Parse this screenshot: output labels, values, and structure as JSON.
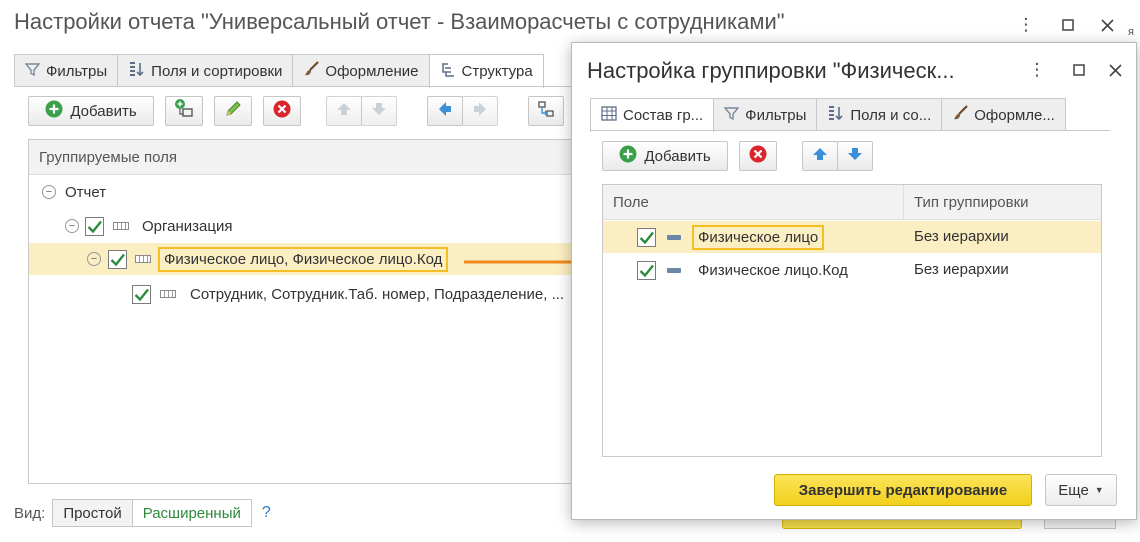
{
  "main": {
    "title": "Настройки отчета \"Универсальный отчет - Взаиморасчеты с сотрудниками\"",
    "clipped_text": "я",
    "tabs": [
      {
        "label": "Фильтры",
        "icon": "funnel-icon"
      },
      {
        "label": "Поля и сортировки",
        "icon": "fields-sort-icon"
      },
      {
        "label": "Оформление",
        "icon": "brush-icon"
      },
      {
        "label": "Структура",
        "icon": "structure-icon",
        "active": true
      }
    ],
    "toolbar": {
      "add_label": "Добавить",
      "icons": [
        "add-icon",
        "group-add-icon",
        "pencil-icon",
        "delete-icon",
        "move-up-icon",
        "move-down-icon",
        "move-left-icon",
        "move-right-icon",
        "swap-icon"
      ]
    },
    "list": {
      "header": "Группируемые поля",
      "rows": [
        {
          "label": "Отчет",
          "level": 0,
          "checked": false,
          "expanded": true
        },
        {
          "label": "Организация",
          "level": 1,
          "checked": true,
          "expanded": true
        },
        {
          "label": "Физическое лицо, Физическое лицо.Код",
          "level": 2,
          "checked": true,
          "expanded": true,
          "selected": true
        },
        {
          "label": "Сотрудник, Сотрудник.Таб. номер, Подразделение, ...",
          "level": 3,
          "checked": true
        }
      ]
    },
    "view": {
      "label": "Вид:",
      "simple": "Простой",
      "extended": "Расширенный",
      "help": "?"
    }
  },
  "dialog": {
    "title": "Настройка группировки \"Физическ...",
    "tabs": [
      {
        "label": "Состав гр...",
        "icon": "table-icon",
        "active": true
      },
      {
        "label": "Фильтры",
        "icon": "funnel-icon"
      },
      {
        "label": "Поля и со...",
        "icon": "fields-sort-icon"
      },
      {
        "label": "Оформле...",
        "icon": "brush-icon"
      }
    ],
    "toolbar": {
      "add_label": "Добавить"
    },
    "columns": [
      "Поле",
      "Тип группировки"
    ],
    "rows": [
      {
        "field": "Физическое лицо",
        "type": "Без иерархии",
        "checked": true,
        "selected": true
      },
      {
        "field": "Физическое лицо.Код",
        "type": "Без иерархии",
        "checked": true
      }
    ],
    "finish_label": "Завершить редактирование",
    "more_label": "Еще"
  },
  "colors": {
    "highlight": "#f3bf25",
    "selected_row": "#fbeec2",
    "arrow": "#f08a1c",
    "check": "#2e8b3e",
    "primary_button": "#f7dc3c"
  }
}
